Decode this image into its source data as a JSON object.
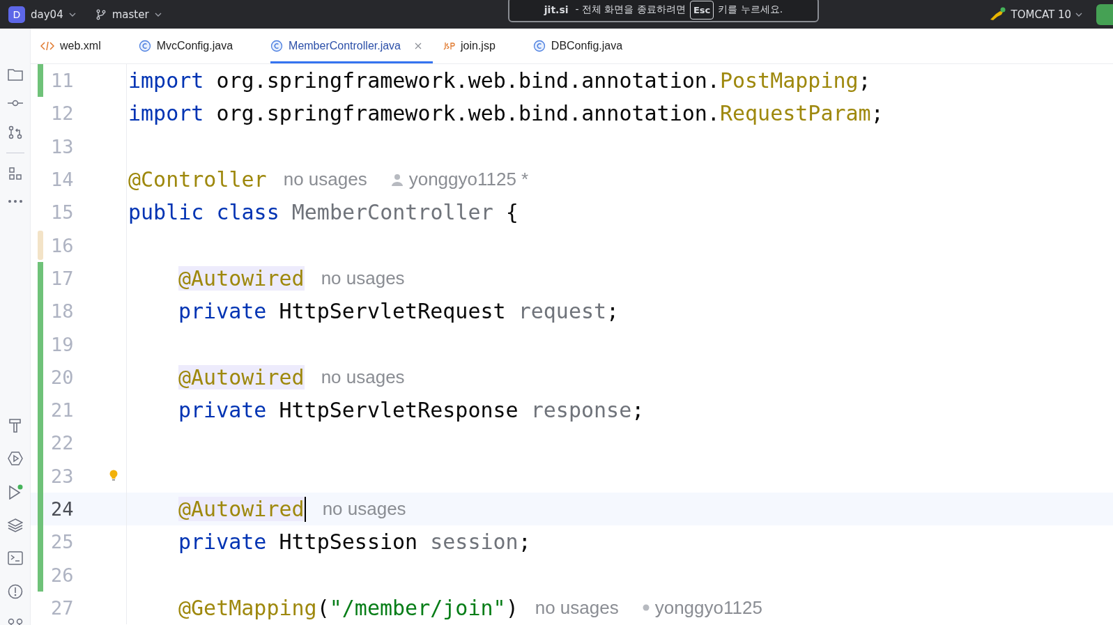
{
  "toolbar": {
    "project_badge": "D",
    "project": "day04",
    "branch": "master",
    "run_config": "TOMCAT 10"
  },
  "fullscreen_notice": {
    "site": "jit.si",
    "before": "- 전체 화면을 종료하려면",
    "key": "Esc",
    "after": "키를 누르세요."
  },
  "tabs": [
    {
      "label": "web.xml",
      "kind": "xml",
      "selected": false
    },
    {
      "label": "MvcConfig.java",
      "kind": "class",
      "selected": false
    },
    {
      "label": "MemberController.java",
      "kind": "class",
      "selected": true
    },
    {
      "label": "join.jsp",
      "kind": "jsp",
      "selected": false
    },
    {
      "label": "DBConfig.java",
      "kind": "class",
      "selected": false
    }
  ],
  "editor": {
    "lines": [
      {
        "number": "11",
        "added": true,
        "modified": false,
        "current": false,
        "bulb": false,
        "indented": false,
        "tokens": [
          {
            "kind": "keyword",
            "text": "import"
          },
          {
            "kind": "plain",
            "text": " org.springframework.web.bind.annotation."
          },
          {
            "kind": "unused",
            "text": "PostMapping"
          },
          {
            "kind": "plain",
            "text": ";"
          }
        ]
      },
      {
        "number": "12",
        "added": false,
        "modified": false,
        "current": false,
        "bulb": false,
        "indented": false,
        "tokens": [
          {
            "kind": "keyword",
            "text": "import"
          },
          {
            "kind": "plain",
            "text": " org.springframework.web.bind.annotation."
          },
          {
            "kind": "unused",
            "text": "RequestParam"
          },
          {
            "kind": "plain",
            "text": ";"
          }
        ]
      },
      {
        "number": "13",
        "added": false,
        "modified": false,
        "current": false,
        "bulb": false,
        "indented": false
      },
      {
        "number": "14",
        "added": false,
        "modified": false,
        "current": false,
        "bulb": false,
        "indented": false,
        "tokens": [
          {
            "kind": "annotation",
            "text": "@Controller",
            "highlighted": false
          },
          {
            "kind": "hint",
            "text": "no usages"
          },
          {
            "kind": "author",
            "text": "yonggyo1125 *"
          }
        ]
      },
      {
        "number": "15",
        "added": false,
        "modified": false,
        "current": false,
        "bulb": false,
        "indented": false,
        "tokens": [
          {
            "kind": "keyword",
            "text": "public class"
          },
          {
            "kind": "grey",
            "text": "MemberController",
            "space": true
          },
          {
            "kind": "plain",
            "text": "{",
            "space": true
          }
        ]
      },
      {
        "number": "16",
        "added": false,
        "modified": true,
        "current": false,
        "bulb": false,
        "indented": false
      },
      {
        "number": "17",
        "added": true,
        "modified": false,
        "current": false,
        "bulb": false,
        "indented": true,
        "tokens": [
          {
            "kind": "annotation",
            "text": "@Autowired",
            "highlighted": true
          },
          {
            "kind": "hint",
            "text": "no usages"
          }
        ]
      },
      {
        "number": "18",
        "added": true,
        "modified": false,
        "current": false,
        "bulb": false,
        "indented": true,
        "tokens": [
          {
            "kind": "keyword",
            "text": "private"
          },
          {
            "kind": "plain",
            "text": " HttpServletRequest "
          },
          {
            "kind": "grey",
            "text": "request"
          },
          {
            "kind": "plain",
            "text": ";"
          }
        ]
      },
      {
        "number": "19",
        "added": true,
        "modified": false,
        "current": false,
        "bulb": false,
        "indented": false
      },
      {
        "number": "20",
        "added": true,
        "modified": false,
        "current": false,
        "bulb": false,
        "indented": true,
        "tokens": [
          {
            "kind": "annotation",
            "text": "@Autowired",
            "highlighted": true
          },
          {
            "kind": "hint",
            "text": "no usages"
          }
        ]
      },
      {
        "number": "21",
        "added": true,
        "modified": false,
        "current": false,
        "bulb": false,
        "indented": true,
        "tokens": [
          {
            "kind": "keyword",
            "text": "private"
          },
          {
            "kind": "plain",
            "text": " HttpServletResponse "
          },
          {
            "kind": "grey",
            "text": "response"
          },
          {
            "kind": "plain",
            "text": ";"
          }
        ]
      },
      {
        "number": "22",
        "added": true,
        "modified": false,
        "current": false,
        "bulb": false,
        "indented": false
      },
      {
        "number": "23",
        "added": true,
        "modified": false,
        "current": false,
        "bulb": true,
        "indented": false
      },
      {
        "number": "24",
        "added": true,
        "modified": false,
        "current": true,
        "bulb": false,
        "indented": true,
        "tokens": [
          {
            "kind": "annotation",
            "text": "@Autowired",
            "highlighted": true
          },
          {
            "kind": "caret"
          },
          {
            "kind": "hint",
            "text": "no usages"
          }
        ]
      },
      {
        "number": "25",
        "added": true,
        "modified": false,
        "current": false,
        "bulb": false,
        "indented": true,
        "tokens": [
          {
            "kind": "keyword",
            "text": "private"
          },
          {
            "kind": "plain",
            "text": " HttpSession "
          },
          {
            "kind": "grey",
            "text": "session"
          },
          {
            "kind": "plain",
            "text": ";"
          }
        ]
      },
      {
        "number": "26",
        "added": true,
        "modified": false,
        "current": false,
        "bulb": false,
        "indented": false
      },
      {
        "number": "27",
        "added": false,
        "modified": false,
        "current": false,
        "bulb": false,
        "indented": true,
        "tokens": [
          {
            "kind": "annotation",
            "text": "@GetMapping",
            "highlighted": false
          },
          {
            "kind": "plain",
            "text": "("
          },
          {
            "kind": "string",
            "text": "\"/member/join\""
          },
          {
            "kind": "plain",
            "text": ")"
          },
          {
            "kind": "hint",
            "text": "no usages"
          },
          {
            "kind": "author_dot",
            "text": "yonggyo1125"
          }
        ]
      }
    ]
  }
}
